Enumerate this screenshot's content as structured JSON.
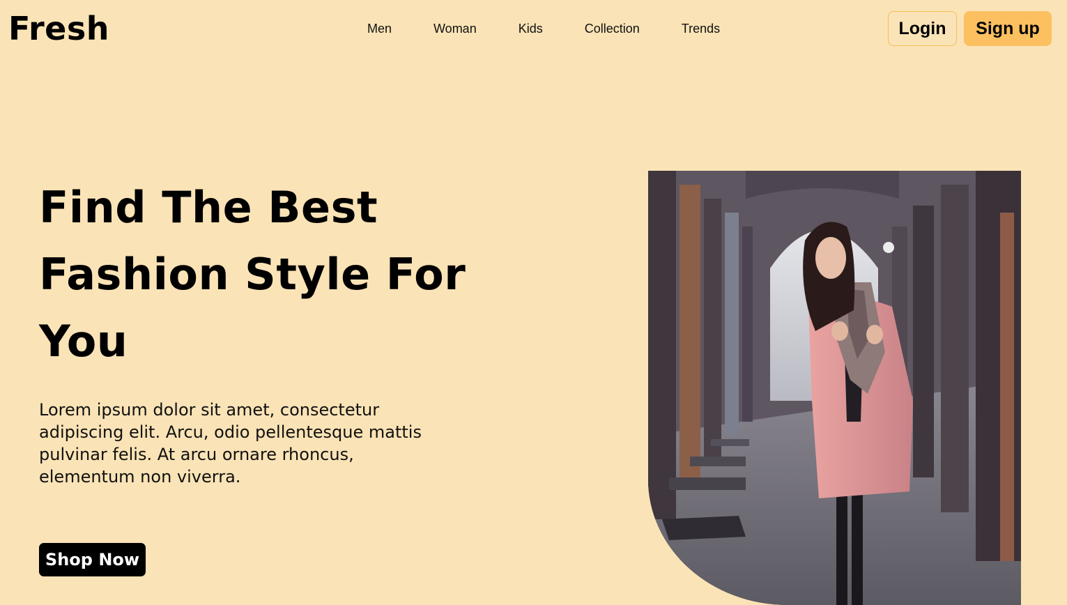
{
  "brand": {
    "name": "Fresh"
  },
  "nav": {
    "items": [
      "Men",
      "Woman",
      "Kids",
      "Collection",
      "Trends"
    ]
  },
  "auth": {
    "login_label": "Login",
    "signup_label": "Sign up"
  },
  "hero": {
    "title": "Find The Best Fashion Style For You",
    "description": "Lorem ipsum dolor sit amet, consectetur adipiscing elit. Arcu, odio pellentesque mattis pulvinar felis. At arcu ornare rhoncus, elementum non viverra.",
    "cta_label": "Shop Now",
    "image": "woman-in-pink-coat-arcade-photo"
  },
  "colors": {
    "background": "#FAE3B6",
    "accent": "#FCC061",
    "login_border": "#F6BE5A",
    "cta_bg": "#000000",
    "cta_text": "#FFFFFF"
  }
}
